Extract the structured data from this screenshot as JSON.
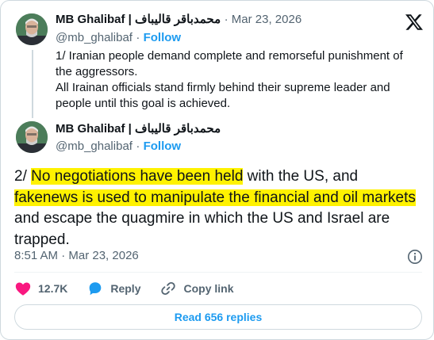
{
  "tweet1": {
    "name": "MB Ghalibaf | محمدباقر قالیباف",
    "date": "Mar 23, 2026",
    "handle": "@mb_ghalibaf",
    "follow": "Follow",
    "body_line1": "1/ Iranian people demand complete and remorseful punishment of the aggressors.",
    "body_line2": "All Irainan officials stand firmly behind their supreme leader and people until this goal is achieved."
  },
  "tweet2": {
    "name": "MB Ghalibaf | محمدباقر قالیباف",
    "handle": "@mb_ghalibaf",
    "follow": "Follow",
    "text_a": "2/ ",
    "text_b": "No negotiations have been held",
    "text_c": " with the US, and ",
    "text_d": "fakenews is used to manipulate the financial and oil markets",
    "text_e": " and escape the quagmire in which the US and Israel are trapped.",
    "timestamp": "8:51 AM · Mar 23, 2026"
  },
  "actions": {
    "likes": "12.7K",
    "reply": "Reply",
    "copy_link": "Copy link"
  },
  "read_replies": "Read 656 replies",
  "colors": {
    "accent": "#1d9bf0",
    "like": "#f91880",
    "highlight": "#fff200",
    "secondary_text": "#536471"
  },
  "icons": [
    "x-logo-icon",
    "info-icon",
    "heart-icon",
    "reply-bubble-icon",
    "link-icon"
  ]
}
